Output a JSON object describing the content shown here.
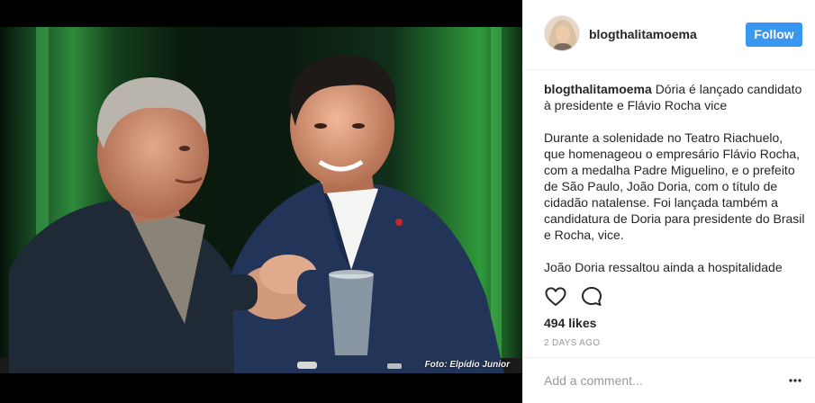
{
  "photo": {
    "credit": "Foto: Elpídio Junior"
  },
  "post": {
    "username": "blogthalitamoema",
    "follow_label": "Follow",
    "caption_title": "Dória é lançado candidato à presidente e Flávio Rocha vice",
    "caption_paragraphs": [
      "Durante a solenidade no Teatro Riachuelo, que homenageou o empresário Flávio Rocha, com a medalha Padre Miguelino, e o prefeito de São Paulo, João Doria, com o título de cidadão natalense. Foi lançada também a candidatura de Doria para presidente do Brasil e Rocha, vice.",
      "João Doria ressaltou ainda a hospitalidade"
    ],
    "likes": "494 likes",
    "timestamp": "2 DAYS AGO",
    "comment_placeholder": "Add a comment..."
  },
  "icons": {
    "like": "heart-outline-icon",
    "comment": "speech-bubble-icon",
    "more": "ellipsis-icon"
  },
  "colors": {
    "follow_button": "#3897f0",
    "text": "#262626",
    "muted": "#999999"
  }
}
